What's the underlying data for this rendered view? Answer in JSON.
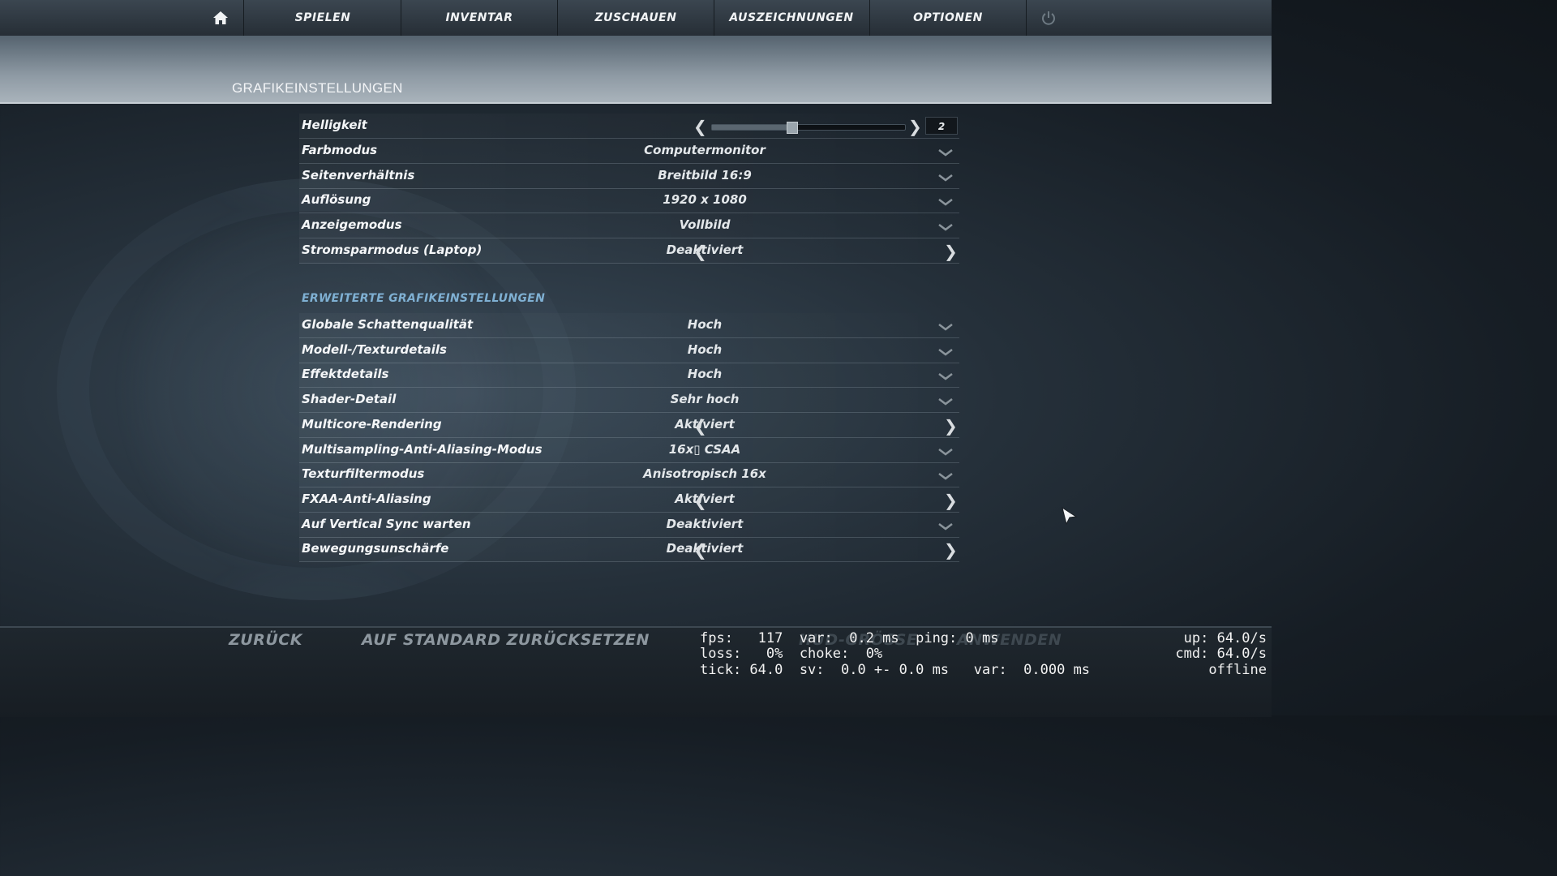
{
  "nav": {
    "items": [
      "SPIELEN",
      "INVENTAR",
      "ZUSCHAUEN",
      "AUSZEICHNUNGEN",
      "OPTIONEN"
    ],
    "home_icon": "home-icon",
    "power_icon": "power-icon"
  },
  "page_title": "GRAFIKEINSTELLUNGEN",
  "settings": {
    "brightness": {
      "label": "Helligkeit",
      "value": "2",
      "level": 0.41
    },
    "rows": [
      {
        "label": "Farbmodus",
        "value": "Computermonitor",
        "control": "dropdown"
      },
      {
        "label": "Seitenverhältnis",
        "value": "Breitbild 16:9",
        "control": "dropdown"
      },
      {
        "label": "Auflösung",
        "value": "1920 x 1080",
        "control": "dropdown"
      },
      {
        "label": "Anzeigemodus",
        "value": "Vollbild",
        "control": "dropdown"
      },
      {
        "label": "Stromsparmodus (Laptop)",
        "value": "Deaktiviert",
        "control": "toggle"
      }
    ],
    "advanced_heading": "ERWEITERTE GRAFIKEINSTELLUNGEN",
    "advanced": [
      {
        "label": "Globale Schattenqualität",
        "value": "Hoch",
        "control": "dropdown"
      },
      {
        "label": "Modell-/Texturdetails",
        "value": "Hoch",
        "control": "dropdown"
      },
      {
        "label": "Effektdetails",
        "value": "Hoch",
        "control": "dropdown"
      },
      {
        "label": "Shader-Detail",
        "value": "Sehr hoch",
        "control": "dropdown"
      },
      {
        "label": "Multicore-Rendering",
        "value": "Aktiviert",
        "control": "toggle"
      },
      {
        "label": "Multisampling-Anti-Aliasing-Modus",
        "value": "16x▯ CSAA",
        "control": "dropdown"
      },
      {
        "label": "Texturfiltermodus",
        "value": "Anisotropisch 16x",
        "control": "dropdown"
      },
      {
        "label": "FXAA-Anti-Aliasing",
        "value": "Aktiviert",
        "control": "toggle"
      },
      {
        "label": "Auf Vertical Sync warten",
        "value": "Deaktiviert",
        "control": "dropdown"
      },
      {
        "label": "Bewegungsunschärfe",
        "value": "Deaktiviert",
        "control": "toggle"
      }
    ]
  },
  "bottom": {
    "back": "ZURÜCK",
    "reset": "AUF STANDARD ZURÜCKSETZEN",
    "hidden_btn_1": "HUD-GRÖSSE",
    "hidden_btn_2": "ANWENDEN"
  },
  "netgraph": {
    "line1": "fps:   117  var:  0.2 ms  ping: 0 ms",
    "line2": "loss:   0%  choke:  0%",
    "line3": "tick: 64.0  sv:  0.0 +- 0.0 ms   var:  0.000 ms",
    "right1": "up: 64.0/s",
    "right2": "cmd: 64.0/s",
    "right3": "offline"
  },
  "colors": {
    "accent_heading": "#7fb0d3",
    "text": "#f4f6f8",
    "bottom_button": "#8d979f"
  }
}
